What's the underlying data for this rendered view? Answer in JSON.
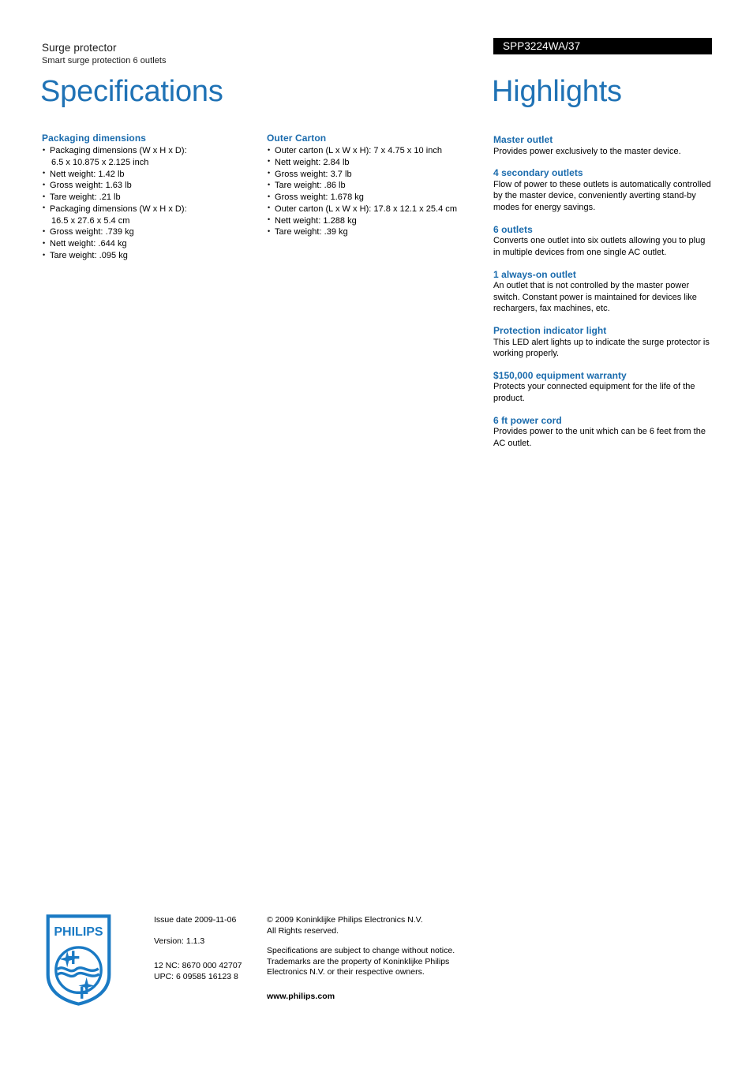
{
  "header": {
    "product_name": "Surge protector",
    "product_tagline": "Smart surge protection 6 outlets",
    "product_code": "SPP3224WA/37",
    "left_title": "Specifications",
    "right_title": "Highlights"
  },
  "colors": {
    "heading_blue": "#1a6bad",
    "title_blue": "#1f72b5",
    "code_bar_bg": "#000000",
    "logo_blue": "#1a7ac4"
  },
  "specifications": [
    {
      "section": "Packaging dimensions",
      "items": [
        {
          "line1": "Packaging dimensions (W x H x D):",
          "line2": "6.5 x 10.875 x 2.125 inch"
        },
        {
          "line1": "Nett weight: 1.42 lb"
        },
        {
          "line1": "Gross weight: 1.63 lb"
        },
        {
          "line1": "Tare weight: .21 lb"
        },
        {
          "line1": "Packaging dimensions (W x H x D):",
          "line2": "16.5 x 27.6 x 5.4 cm"
        },
        {
          "line1": "Gross weight: .739 kg"
        },
        {
          "line1": "Nett weight: .644 kg"
        },
        {
          "line1": "Tare weight: .095 kg"
        }
      ]
    },
    {
      "section": "Outer Carton",
      "items": [
        {
          "line1": "Outer carton (L x W x H): 7 x 4.75 x 10 inch"
        },
        {
          "line1": "Nett weight: 2.84 lb"
        },
        {
          "line1": "Gross weight: 3.7 lb"
        },
        {
          "line1": "Tare weight: .86 lb"
        },
        {
          "line1": "Gross weight: 1.678 kg"
        },
        {
          "line1": "Outer carton (L x W x H): 17.8 x 12.1 x 25.4 cm"
        },
        {
          "line1": "Nett weight: 1.288 kg"
        },
        {
          "line1": "Tare weight: .39 kg"
        }
      ]
    }
  ],
  "highlights": [
    {
      "title": "Master outlet",
      "body": "Provides power exclusively to the master device."
    },
    {
      "title": "4 secondary outlets",
      "body": "Flow of power to these outlets is automatically controlled by the master device, conveniently averting stand-by modes for energy savings."
    },
    {
      "title": "6 outlets",
      "body": "Converts one outlet into six outlets allowing you to plug in multiple devices from one single AC outlet."
    },
    {
      "title": "1 always-on outlet",
      "body": "An outlet that is not controlled by the master power switch. Constant power is maintained for devices like rechargers, fax machines, etc."
    },
    {
      "title": "Protection indicator light",
      "body": "This LED alert lights up to indicate the surge protector is working properly."
    },
    {
      "title": "$150,000 equipment warranty",
      "body": "Protects your connected equipment for the life of the product."
    },
    {
      "title": "6 ft power cord",
      "body": "Provides power to the unit which can be 6 feet from the AC outlet."
    }
  ],
  "footer": {
    "logo_wordmark": "PHILIPS",
    "issue_date": "Issue date 2009-11-06",
    "version": "Version: 1.1.3",
    "twelve_nc": "12 NC: 8670 000 42707",
    "upc": "UPC: 6 09585 16123 8",
    "copyright_line1": "© 2009 Koninklijke Philips Electronics N.V.",
    "copyright_line2": "All Rights reserved.",
    "disclaimer_line1": "Specifications are subject to change without notice.",
    "disclaimer_line2": "Trademarks are the property of Koninklijke Philips",
    "disclaimer_line3": "Electronics N.V. or their respective owners.",
    "website": "www.philips.com"
  }
}
